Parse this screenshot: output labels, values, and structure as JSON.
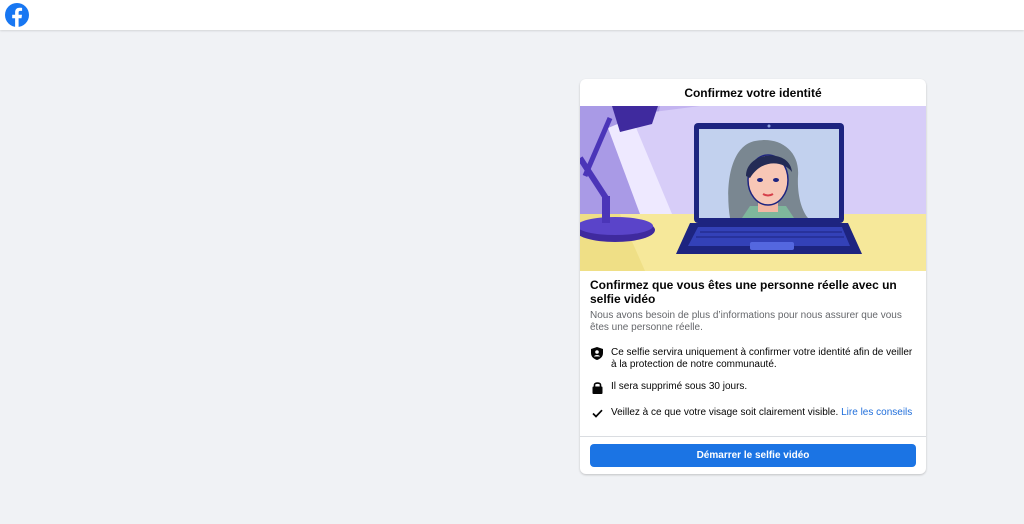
{
  "app": {
    "logo_icon": "facebook-logo-icon",
    "brand_color": "#1877f2"
  },
  "dialog": {
    "header_title": "Confirmez votre identité",
    "illustration": "person-on-laptop-video-selfie-illustration",
    "title": "Confirmez que vous êtes une personne réelle avec un selfie vidéo",
    "subtitle": "Nous avons besoin de plus d’informations pour nous assurer que vous êtes une personne réelle.",
    "items": [
      {
        "icon": "shield-person-icon",
        "text": "Ce selfie servira uniquement à confirmer votre identité afin de veiller à la protection de notre communauté."
      },
      {
        "icon": "lock-icon",
        "text": "Il sera supprimé sous 30 jours."
      },
      {
        "icon": "checkmark-icon",
        "text": "Veillez à ce que votre visage soit clairement visible.",
        "link_text": "Lire les conseils"
      }
    ],
    "primary_button": "Démarrer le selfie vidéo",
    "button_color": "#1b74e4"
  }
}
